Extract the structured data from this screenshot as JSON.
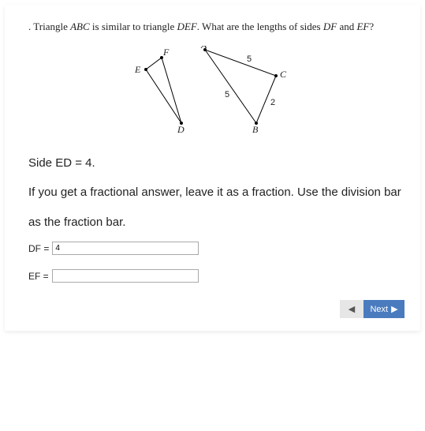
{
  "question": {
    "prefix": ". Triangle ",
    "t1": "ABC",
    "mid1": " is similar to triangle ",
    "t2": "DEF",
    "mid2": ". What are the lengths of sides ",
    "s1": "DF",
    "mid3": " and ",
    "s2": "EF",
    "suffix": "?"
  },
  "diagram": {
    "labels": {
      "A": "A",
      "B": "B",
      "C": "C",
      "D": "D",
      "E": "E",
      "F": "F",
      "AC": "5",
      "AB": "5",
      "BC": "2"
    }
  },
  "instructions": {
    "line1": "Side ED =  4.",
    "line2": "If you get a fractional answer, leave it as a fraction. Use the division bar as the fraction bar."
  },
  "inputs": {
    "df_label": "DF =",
    "df_value": "4",
    "ef_label": "EF =",
    "ef_value": ""
  },
  "nav": {
    "prev_icon": "◀",
    "next_label": "Next",
    "next_icon": "▶"
  }
}
